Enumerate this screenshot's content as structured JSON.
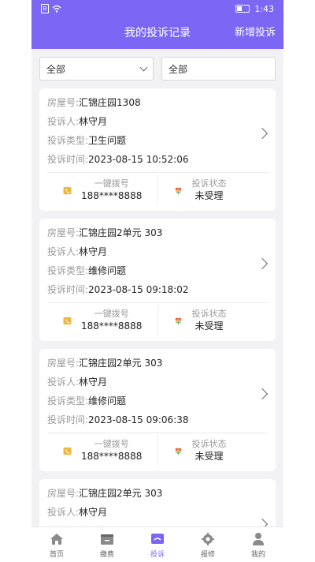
{
  "statusbar": {
    "time": "1:43"
  },
  "header": {
    "title": "我的投诉记录",
    "action": "新增投诉"
  },
  "filters": {
    "left": "全部",
    "right": "全部"
  },
  "labels": {
    "house": "房屋号:",
    "person": "投诉人:",
    "type": "投诉类型:",
    "time": "投诉时间:",
    "call": "一键拨号",
    "status": "投诉状态"
  },
  "records": [
    {
      "house": "汇锦庄园1308",
      "person": "林守月",
      "type": "卫生问题",
      "time": "2023-08-15 10:52:06",
      "phone": "188****8888",
      "status": "未受理"
    },
    {
      "house": "汇锦庄园2单元 303",
      "person": "林守月",
      "type": "维修问题",
      "time": "2023-08-15 09:18:02",
      "phone": "188****8888",
      "status": "未受理"
    },
    {
      "house": "汇锦庄园2单元 303",
      "person": "林守月",
      "type": "维修问题",
      "time": "2023-08-15 09:06:38",
      "phone": "188****8888",
      "status": "未受理"
    },
    {
      "house": "汇锦庄园2单元 303",
      "person": "林守月",
      "type": "卫生问题"
    }
  ],
  "tabs": [
    {
      "label": "首页",
      "icon": "home-icon"
    },
    {
      "label": "缴费",
      "icon": "payment-icon"
    },
    {
      "label": "投诉",
      "icon": "complaint-icon",
      "active": true
    },
    {
      "label": "报修",
      "icon": "repair-icon"
    },
    {
      "label": "我的",
      "icon": "profile-icon"
    }
  ],
  "colors": {
    "accent": "#7b67f3",
    "call_icon": "#f0b73a",
    "status_icon": "#e86a4a"
  }
}
